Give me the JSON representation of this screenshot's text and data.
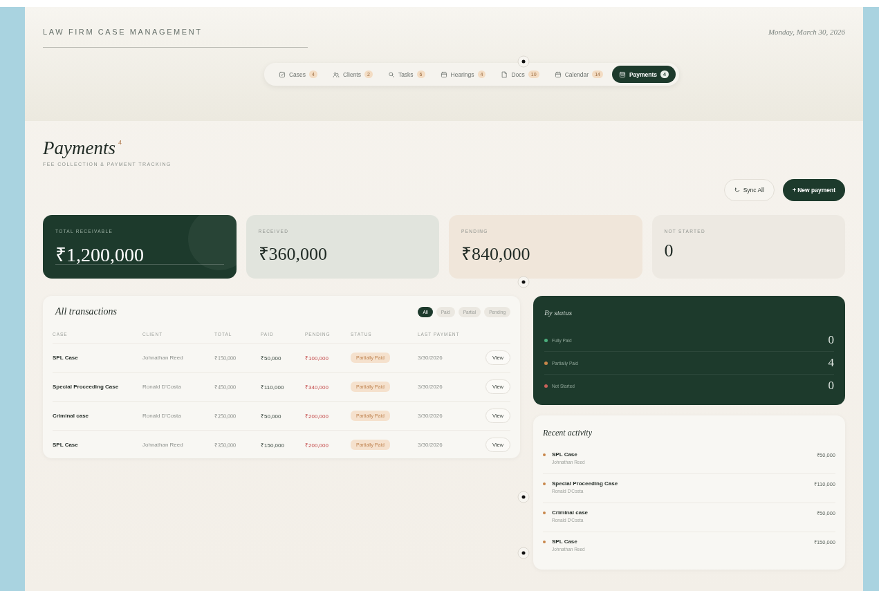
{
  "app_title": "LAW FIRM CASE MANAGEMENT",
  "date": "Monday, March 30, 2026",
  "nav": [
    {
      "label": "Cases",
      "count": "4",
      "kind": "check",
      "selected": false
    },
    {
      "label": "Clients",
      "count": "2",
      "kind": "people",
      "selected": false
    },
    {
      "label": "Tasks",
      "count": "6",
      "kind": "search",
      "selected": false
    },
    {
      "label": "Hearings",
      "count": "4",
      "kind": "calendar",
      "selected": false
    },
    {
      "label": "Docs",
      "count": "10",
      "kind": "doc",
      "selected": false
    },
    {
      "label": "Calendar",
      "count": "14",
      "kind": "calendar",
      "selected": false
    },
    {
      "label": "Payments",
      "count": "4",
      "kind": "card",
      "selected": true
    }
  ],
  "page": {
    "title": "Payments",
    "count": "4",
    "subtitle": "FEE COLLECTION & PAYMENT TRACKING"
  },
  "actions": {
    "sync": "Sync All",
    "new": "+ New payment"
  },
  "stats": [
    {
      "label": "TOTAL RECEIVABLE",
      "value": "₹1,200,000",
      "kind": "dark"
    },
    {
      "label": "RECEIVED",
      "value": "₹360,000",
      "kind": "sage"
    },
    {
      "label": "PENDING",
      "value": "₹840,000",
      "kind": "peach"
    },
    {
      "label": "NOT STARTED",
      "value": "0",
      "kind": "plain"
    }
  ],
  "transactions": {
    "title": "All transactions",
    "filters": [
      {
        "label": "All",
        "selected": true
      },
      {
        "label": "Paid",
        "selected": false
      },
      {
        "label": "Partial",
        "selected": false
      },
      {
        "label": "Pending",
        "selected": false
      }
    ],
    "columns": [
      "CASE",
      "CLIENT",
      "TOTAL",
      "PAID",
      "PENDING",
      "STATUS",
      "LAST PAYMENT"
    ],
    "rows": [
      {
        "case": "SPL Case",
        "client": "Johnathan Reed",
        "total": "₹150,000",
        "paid": "₹50,000",
        "pending": "₹100,000",
        "status": "Partially Paid",
        "last_payment": "3/30/2026",
        "action": "View"
      },
      {
        "case": "Special Proceeding Case",
        "client": "Ronald D'Costa",
        "total": "₹450,000",
        "paid": "₹110,000",
        "pending": "₹340,000",
        "status": "Partially Paid",
        "last_payment": "3/30/2026",
        "action": "View"
      },
      {
        "case": "Criminal case",
        "client": "Ronald D'Costa",
        "total": "₹250,000",
        "paid": "₹50,000",
        "pending": "₹200,000",
        "status": "Partially Paid",
        "last_payment": "3/30/2026",
        "action": "View"
      },
      {
        "case": "SPL Case",
        "client": "Johnathan Reed",
        "total": "₹350,000",
        "paid": "₹150,000",
        "pending": "₹200,000",
        "status": "Partially Paid",
        "last_payment": "3/30/2026",
        "action": "View"
      }
    ]
  },
  "by_status": {
    "title": "By status",
    "items": [
      {
        "label": "Fully Paid",
        "count": "0",
        "color": "#4caf7d"
      },
      {
        "label": "Partially Paid",
        "count": "4",
        "color": "#c8864a"
      },
      {
        "label": "Not Started",
        "count": "0",
        "color": "#c9625a"
      }
    ]
  },
  "recent_activity": {
    "title": "Recent activity",
    "items": [
      {
        "case": "SPL Case",
        "client": "Johnathan Reed",
        "amount": "₹50,000"
      },
      {
        "case": "Special Proceeding Case",
        "client": "Ronald D'Costa",
        "amount": "₹110,000"
      },
      {
        "case": "Criminal case",
        "client": "Ronald D'Costa",
        "amount": "₹50,000"
      },
      {
        "case": "SPL Case",
        "client": "Johnathan Reed",
        "amount": "₹150,000"
      }
    ]
  }
}
